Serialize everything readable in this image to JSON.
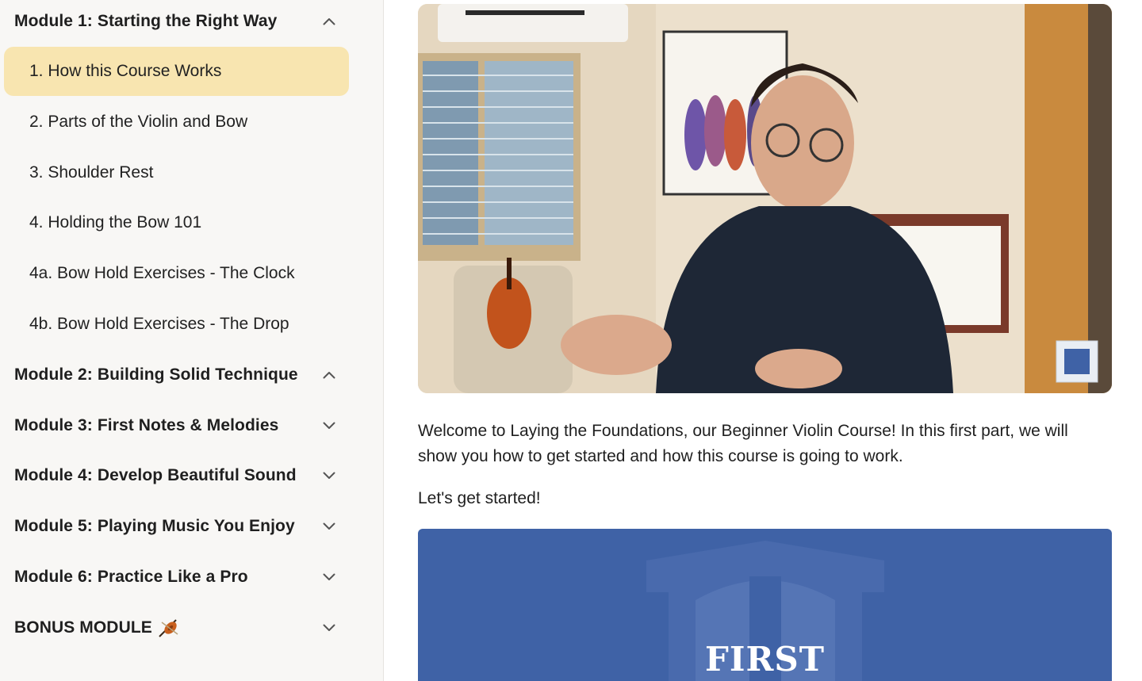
{
  "sidebar": {
    "modules": [
      {
        "title": "Module 1: Starting the Right Way",
        "chevron": "chevron-up-icon"
      },
      {
        "title": "Module 2: Building Solid Technique",
        "chevron": "chevron-up-icon"
      },
      {
        "title": "Module 3: First Notes & Melodies",
        "chevron": "chevron-down-icon"
      },
      {
        "title": "Module 4: Develop Beautiful Sound",
        "chevron": "chevron-down-icon"
      },
      {
        "title": "Module 5: Playing Music You Enjoy",
        "chevron": "chevron-down-icon"
      },
      {
        "title": "Module 6: Practice Like a Pro",
        "chevron": "chevron-down-icon"
      },
      {
        "title": "BONUS MODULE",
        "chevron": "chevron-down-icon",
        "emoji": "violin-icon"
      }
    ],
    "lessons": [
      {
        "label": "1. How this Course Works",
        "active": true
      },
      {
        "label": "2. Parts of the Violin and Bow",
        "active": false
      },
      {
        "label": "3. Shoulder Rest",
        "active": false
      },
      {
        "label": "4. Holding the Bow 101",
        "active": false
      },
      {
        "label": "4a. Bow Hold Exercises - The Clock",
        "active": false
      },
      {
        "label": "4b. Bow Hold Exercises - The Drop",
        "active": false
      }
    ]
  },
  "main": {
    "description": [
      "Welcome to Laying the Foundations, our Beginner Violin Course! In this first part, we will show you how to get started and how this course is going to work.",
      "Let's get started!"
    ],
    "banner_text": "FIRST"
  },
  "colors": {
    "active_lesson_bg": "#f8e5b0",
    "sidebar_bg": "#f8f7f5",
    "banner_bg": "#3f62a6"
  }
}
